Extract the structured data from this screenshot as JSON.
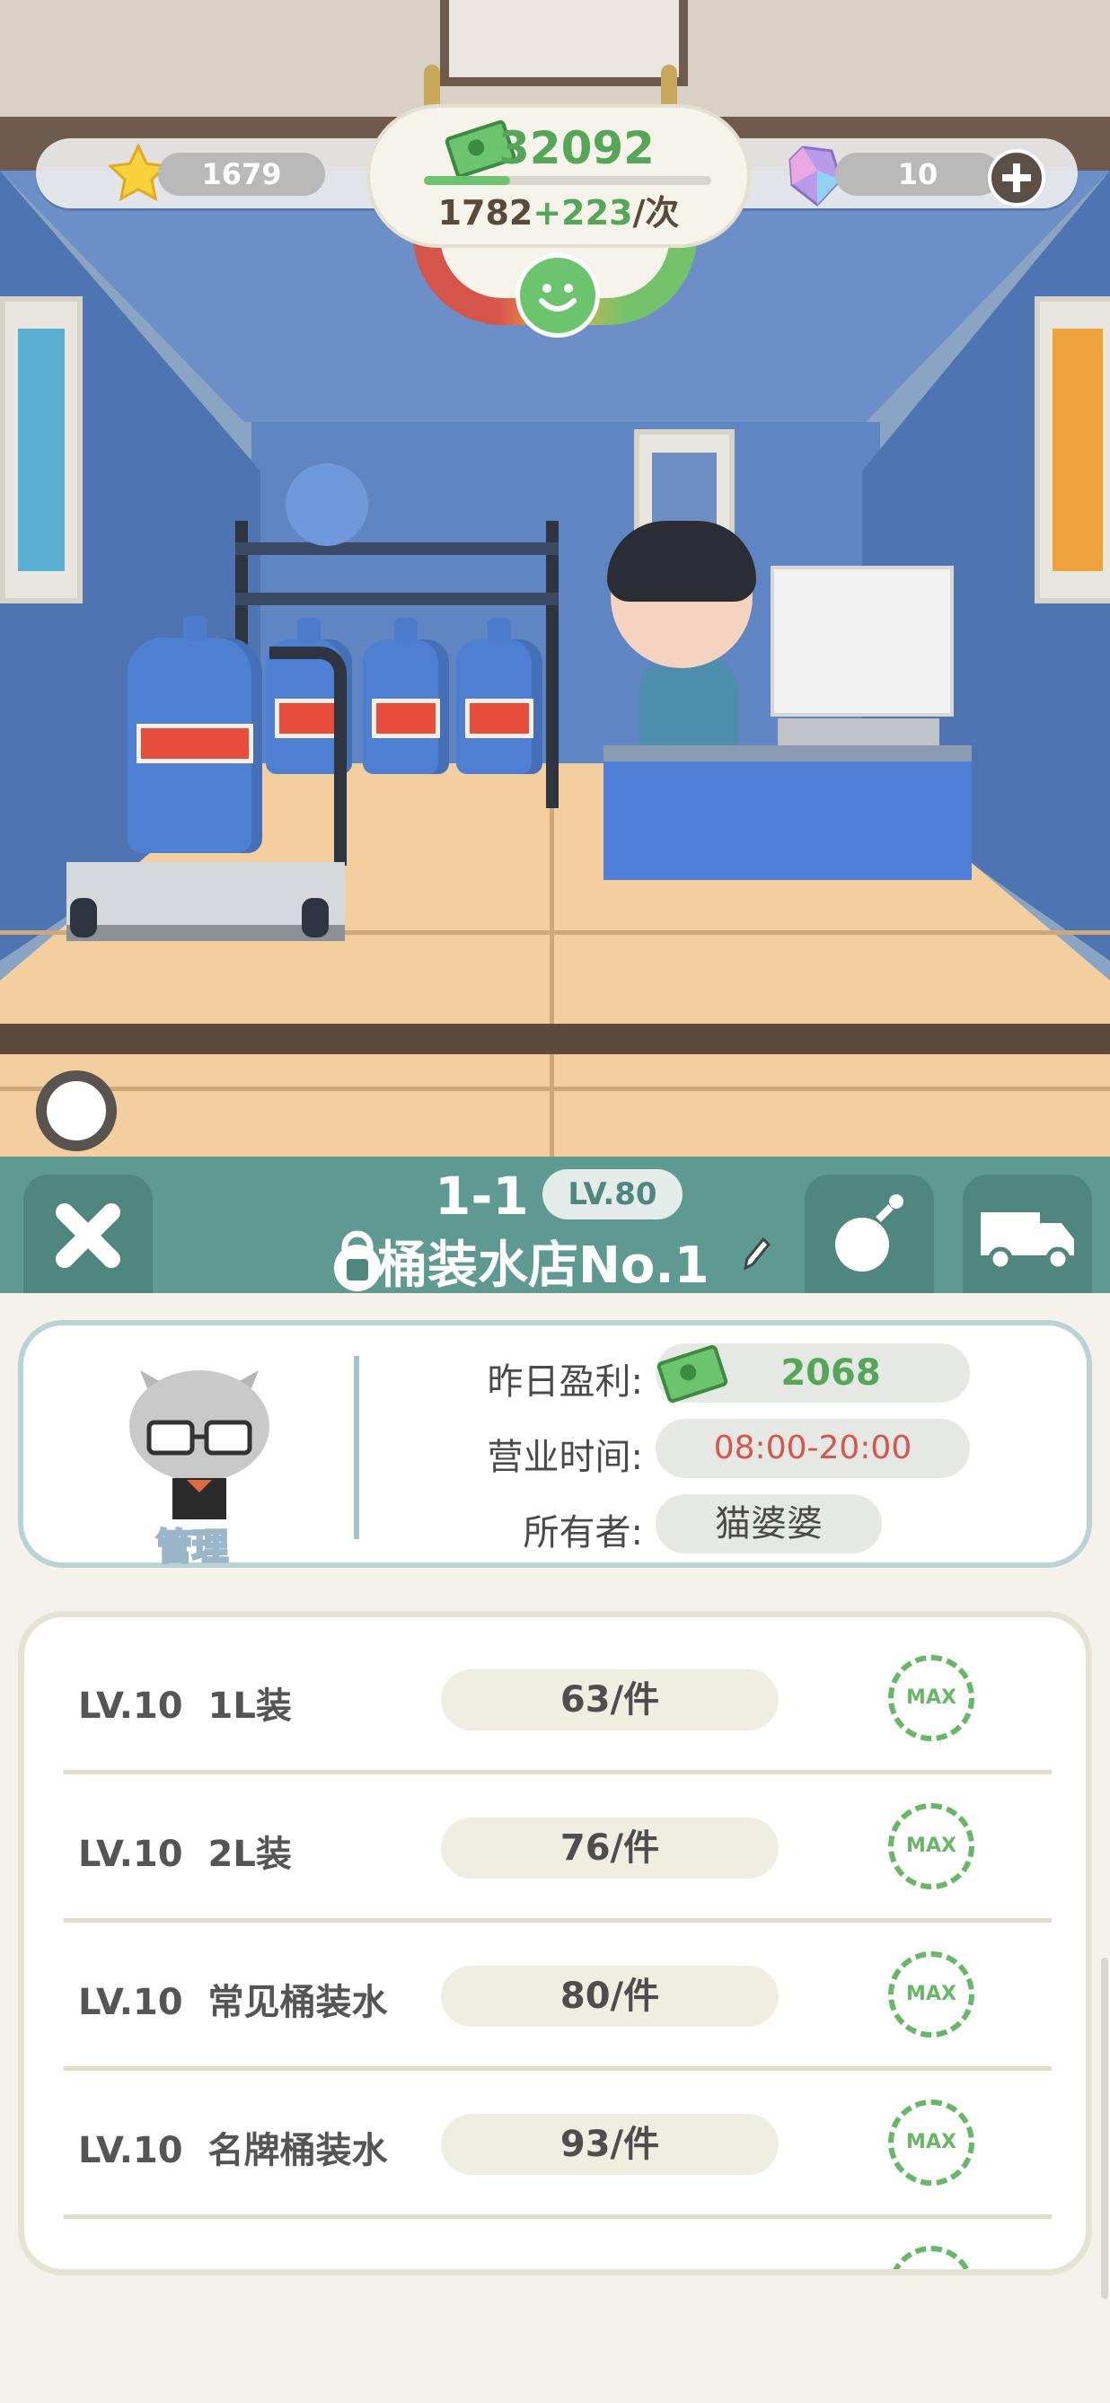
{
  "hud": {
    "stars": "1679",
    "money": "32092",
    "rate_base": "1782",
    "rate_bonus": "+223",
    "rate_unit": "/次",
    "gems": "10",
    "money_progress": 0.3
  },
  "shop": {
    "level_id": "1-1",
    "level_badge": "LV.80",
    "name": "桶装水店No.1"
  },
  "manager": {
    "label": "管理"
  },
  "info": {
    "profit_label": "昨日盈利:",
    "profit_value": "2068",
    "hours_label": "营业时间:",
    "hours_value": "08:00-20:00",
    "owner_label": "所有者:",
    "owner_value": "猫婆婆"
  },
  "products": [
    {
      "level": "LV.10",
      "name": "1L装",
      "price": "63/件",
      "badge": "MAX"
    },
    {
      "level": "LV.10",
      "name": "2L装",
      "price": "76/件",
      "badge": "MAX"
    },
    {
      "level": "LV.10",
      "name": "常见桶装水",
      "price": "80/件",
      "badge": "MAX"
    },
    {
      "level": "LV.10",
      "name": "名牌桶装水",
      "price": "93/件",
      "badge": "MAX"
    }
  ],
  "colors": {
    "teal": "#5e9a91",
    "green_accent": "#56a65a",
    "red_accent": "#d9534f"
  }
}
